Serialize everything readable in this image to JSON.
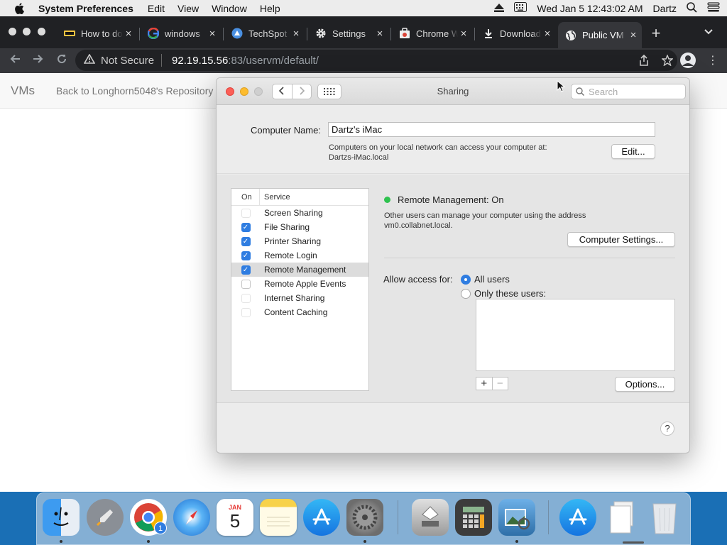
{
  "menubar": {
    "app_name": "System Preferences",
    "items": [
      "Edit",
      "View",
      "Window",
      "Help"
    ],
    "clock": "Wed Jan 5  12:43:02 AM",
    "user": "Dartz"
  },
  "browser": {
    "tabs": [
      {
        "label": "How to do",
        "icon": "favicon-hto"
      },
      {
        "label": "windows",
        "icon": "google-icon"
      },
      {
        "label": "TechSpot",
        "icon": "techspot-icon"
      },
      {
        "label": "Settings",
        "icon": "gear-icon"
      },
      {
        "label": "Chrome Web",
        "icon": "webstore-icon"
      },
      {
        "label": "Downloads",
        "icon": "download-icon"
      },
      {
        "label": "Public VM",
        "icon": "globe-icon",
        "active": true
      }
    ],
    "not_secure": "Not Secure",
    "url_host": "92.19.15.56",
    "url_path": ":83/uservm/default/"
  },
  "webpage": {
    "brand": "VMs",
    "back_link": "Back to Longhorn5048's Repository"
  },
  "sharing": {
    "title": "Sharing",
    "search_placeholder": "Search",
    "computer_name_label": "Computer Name:",
    "computer_name_value": "Dartz's iMac",
    "computer_name_note_line1": "Computers on your local network can access your computer at:",
    "computer_name_note_line2": "Dartzs-iMac.local",
    "edit_button": "Edit...",
    "services_header_on": "On",
    "services_header_service": "Service",
    "services": [
      {
        "name": "Screen Sharing",
        "checked": false,
        "dim": true
      },
      {
        "name": "File Sharing",
        "checked": true
      },
      {
        "name": "Printer Sharing",
        "checked": true
      },
      {
        "name": "Remote Login",
        "checked": true
      },
      {
        "name": "Remote Management",
        "checked": true,
        "selected": true
      },
      {
        "name": "Remote Apple Events",
        "checked": false
      },
      {
        "name": "Internet Sharing",
        "checked": false,
        "dim": true
      },
      {
        "name": "Content Caching",
        "checked": false,
        "dim": true
      }
    ],
    "status_text": "Remote Management: On",
    "status_color": "#2fc24f",
    "status_note_line1": "Other users can manage your computer using the address",
    "status_note_line2": "vm0.collabnet.local.",
    "computer_settings_button": "Computer Settings...",
    "allow_access_label": "Allow access for:",
    "radio_all_users": "All users",
    "radio_only_these": "Only these users:",
    "plus": "+",
    "minus": "−",
    "options_button": "Options...",
    "help": "?"
  },
  "dock": {
    "calendar_month": "JAN",
    "calendar_day": "5",
    "chrome_badge": "1"
  }
}
